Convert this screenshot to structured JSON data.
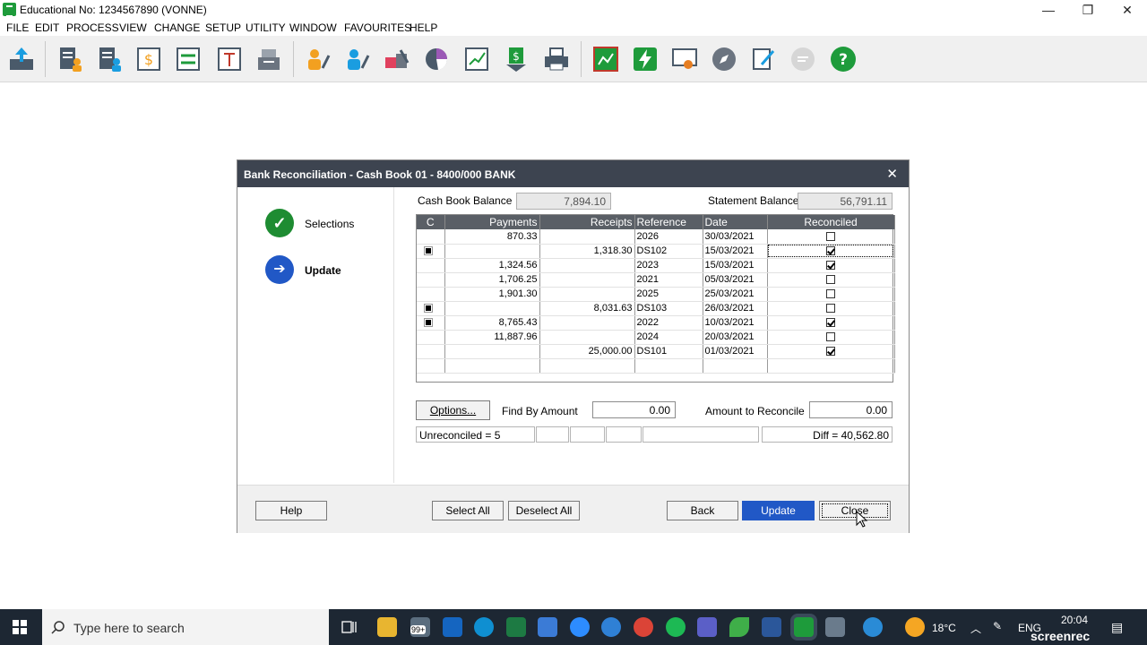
{
  "window": {
    "title": "Educational No: 1234567890 (VONNE)",
    "minimize": "—",
    "restore": "❐",
    "close": "✕"
  },
  "menu": [
    "FILE",
    "EDIT",
    "PROCESS",
    "VIEW",
    "CHANGE",
    "SETUP",
    "UTILITY",
    "WINDOW",
    "FAVOURITES",
    "HELP"
  ],
  "colors": {
    "accent": "#2158c6",
    "toolbar_green": "#1e9b3b",
    "title_dark": "#3d4450"
  },
  "dialog": {
    "title": "Bank Reconciliation - Cash Book 01 -  8400/000 BANK",
    "close": "✕",
    "steps": [
      {
        "label": "Selections",
        "state": "done",
        "glyph": "✓"
      },
      {
        "label": "Update",
        "state": "current",
        "glyph": "➔"
      }
    ],
    "cash_book_balance_label": "Cash Book Balance",
    "cash_book_balance": "7,894.10",
    "statement_balance_label": "Statement Balance",
    "statement_balance": "56,791.11",
    "columns": [
      "C",
      "Payments",
      "Receipts",
      "Reference",
      "Date",
      "Reconciled"
    ],
    "rows": [
      {
        "c": false,
        "payments": "870.33",
        "receipts": "",
        "reference": "2026",
        "date": "30/03/2021",
        "reconciled": false
      },
      {
        "c": true,
        "payments": "",
        "receipts": "1,318.30",
        "reference": "DS102",
        "date": "15/03/2021",
        "reconciled": true
      },
      {
        "c": false,
        "payments": "1,324.56",
        "receipts": "",
        "reference": "2023",
        "date": "15/03/2021",
        "reconciled": true
      },
      {
        "c": false,
        "payments": "1,706.25",
        "receipts": "",
        "reference": "2021",
        "date": "05/03/2021",
        "reconciled": false
      },
      {
        "c": false,
        "payments": "1,901.30",
        "receipts": "",
        "reference": "2025",
        "date": "25/03/2021",
        "reconciled": false
      },
      {
        "c": true,
        "payments": "",
        "receipts": "8,031.63",
        "reference": "DS103",
        "date": "26/03/2021",
        "reconciled": false
      },
      {
        "c": true,
        "payments": "8,765.43",
        "receipts": "",
        "reference": "2022",
        "date": "10/03/2021",
        "reconciled": true
      },
      {
        "c": false,
        "payments": "11,887.96",
        "receipts": "",
        "reference": "2024",
        "date": "20/03/2021",
        "reconciled": false
      },
      {
        "c": false,
        "payments": "",
        "receipts": "25,000.00",
        "reference": "DS101",
        "date": "01/03/2021",
        "reconciled": true
      }
    ],
    "options_button": "Options...",
    "find_by_amount_label": "Find By Amount",
    "find_by_amount": "0.00",
    "amount_to_reconcile_label": "Amount to Reconcile",
    "amount_to_reconcile": "0.00",
    "unreconciled": "Unreconciled =  5",
    "diff": "Diff = 40,562.80",
    "buttons": {
      "help": "Help",
      "select_all": "Select All",
      "deselect_all": "Deselect All",
      "back": "Back",
      "update": "Update",
      "close": "Close"
    }
  },
  "taskbar": {
    "search_placeholder": "Type here to search",
    "badge": "99+",
    "weather": "18°C",
    "language": "ENG",
    "time": "20:04",
    "watermark": "screenrec"
  }
}
